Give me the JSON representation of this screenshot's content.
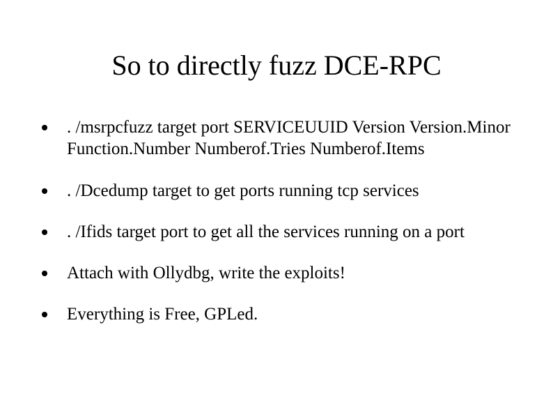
{
  "slide": {
    "title": "So to directly fuzz DCE-RPC",
    "bullets": [
      ". /msrpcfuzz target port SERVICEUUID Version Version.Minor Function.Number Numberof.Tries Numberof.Items",
      ". /Dcedump target to get ports running tcp services",
      ". /Ifids target port to get all the services running on a port",
      "Attach with Ollydbg, write the exploits!",
      "Everything is Free, GPLed."
    ]
  }
}
